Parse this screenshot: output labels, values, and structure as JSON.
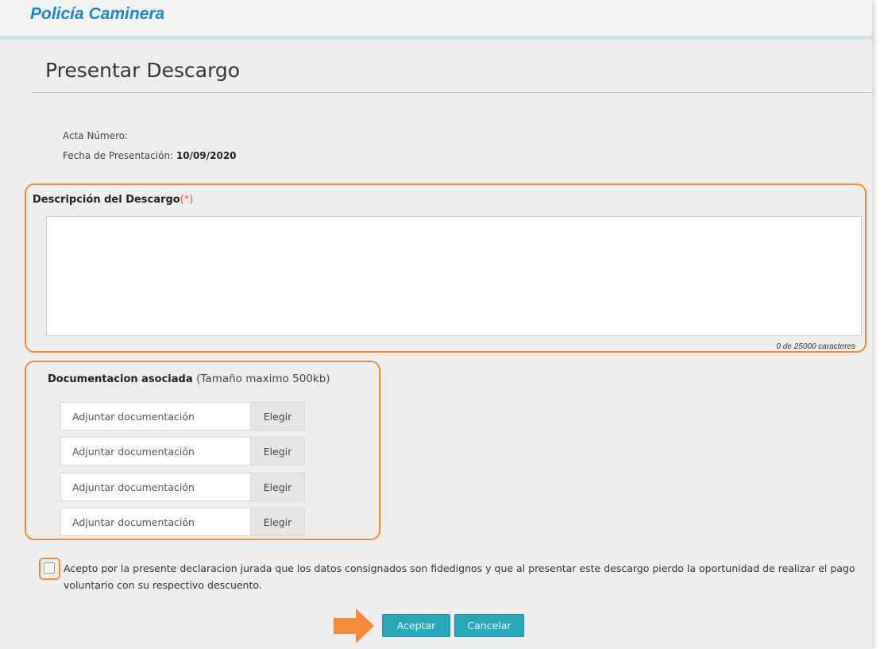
{
  "brand": {
    "title": "Policía Caminera"
  },
  "page": {
    "title": "Presentar Descargo"
  },
  "meta": {
    "acta_label": "Acta Número:",
    "fecha_label": "Fecha de Presentación:",
    "fecha_value": "10/09/2020"
  },
  "descripcion": {
    "label": "Descripción del Descargo",
    "required_mark": "(*)",
    "value": "",
    "char_count": "0 de 25000 caracteres"
  },
  "documentacion": {
    "label": "Documentacion asociada",
    "hint": "(Tamaño maximo 500kb)",
    "files": [
      {
        "placeholder": "Adjuntar documentación",
        "button": "Elegir"
      },
      {
        "placeholder": "Adjuntar documentación",
        "button": "Elegir"
      },
      {
        "placeholder": "Adjuntar documentación",
        "button": "Elegir"
      },
      {
        "placeholder": "Adjuntar documentación",
        "button": "Elegir"
      }
    ]
  },
  "declaracion": {
    "checked": false,
    "text": "Acepto por la presente declaracion jurada que los datos consignados son fidedignos y que al presentar este descargo pierdo la oportunidad de realizar el pago voluntario con su respectivo descuento."
  },
  "actions": {
    "accept_label": "Aceptar",
    "cancel_label": "Cancelar"
  },
  "colors": {
    "brand": "#1a86c9",
    "highlight": "#f58a3a",
    "button": "#2aa7b8",
    "background": "#eeeeee"
  },
  "icons": {
    "pointer": "arrow-right-icon"
  }
}
